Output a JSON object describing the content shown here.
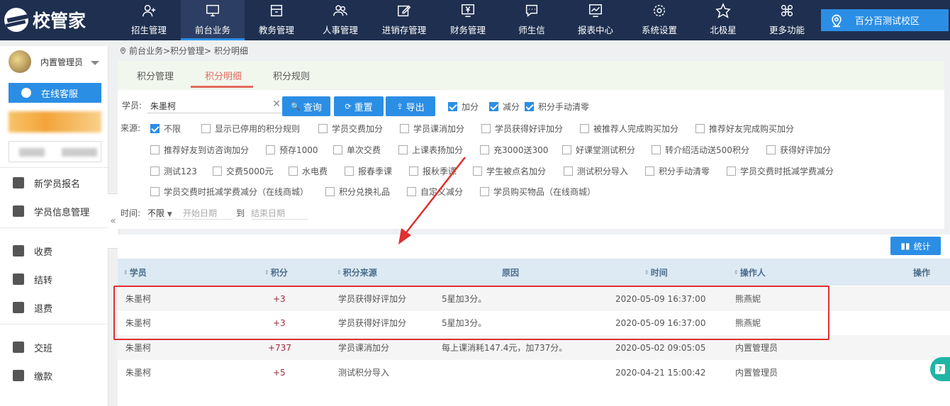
{
  "app": {
    "logo_text": "校管家"
  },
  "nav": [
    {
      "label": "招生管理",
      "icon": "user-plus-icon"
    },
    {
      "label": "前台业务",
      "icon": "monitor-icon",
      "active": true
    },
    {
      "label": "教务管理",
      "icon": "folder-icon"
    },
    {
      "label": "人事管理",
      "icon": "people-icon"
    },
    {
      "label": "进销存管理",
      "icon": "edit-icon"
    },
    {
      "label": "财务管理",
      "icon": "yuan-screen-icon"
    },
    {
      "label": "师生信",
      "icon": "chat-icon"
    },
    {
      "label": "报表中心",
      "icon": "chart-icon"
    },
    {
      "label": "系统设置",
      "icon": "gear-icon"
    },
    {
      "label": "北极星",
      "icon": "star-icon"
    },
    {
      "label": "更多功能",
      "icon": "command-icon"
    }
  ],
  "campus": {
    "label": "百分百测试校区",
    "icon": "location-icon"
  },
  "user": {
    "name": "内置管理员"
  },
  "sidebar": {
    "online_service": "在线客服",
    "items": [
      {
        "label": "新学员报名",
        "icon": "graduation-cap-icon"
      },
      {
        "label": "学员信息管理",
        "icon": "id-card-icon"
      },
      {
        "label": "收费",
        "icon": "wallet-icon"
      },
      {
        "label": "结转",
        "icon": "yuan-transfer-icon"
      },
      {
        "label": "退费",
        "icon": "refund-icon"
      },
      {
        "label": "交班",
        "icon": "handover-icon"
      },
      {
        "label": "缴款",
        "icon": "payment-icon"
      }
    ]
  },
  "breadcrumb": "前台业务>积分管理> 积分明细",
  "tabs": [
    {
      "label": "积分管理"
    },
    {
      "label": "积分明细",
      "active": true
    },
    {
      "label": "积分规则"
    }
  ],
  "filters": {
    "student_label": "学员:",
    "student_value": "朱墨柯",
    "query_btn": "查询",
    "reset_btn": "重置",
    "export_btn": "导出",
    "type_checks": [
      {
        "label": "加分",
        "checked": true
      },
      {
        "label": "减分",
        "checked": true
      },
      {
        "label": "积分手动清零",
        "checked": true
      }
    ],
    "source_label": "来源:",
    "sources": [
      {
        "label": "不限",
        "checked": true
      },
      {
        "label": "显示已停用的积分规则"
      },
      {
        "label": "学员交费加分"
      },
      {
        "label": "学员课消加分"
      },
      {
        "label": "学员获得好评加分"
      },
      {
        "label": "被推荐人完成购买加分"
      },
      {
        "label": "推荐好友完成购买加分"
      },
      {
        "label": "推荐好友到访咨询加分"
      },
      {
        "label": "预存1000"
      },
      {
        "label": "单次交费"
      },
      {
        "label": "上课表扬加分"
      },
      {
        "label": "充3000送300"
      },
      {
        "label": "好课堂测试积分"
      },
      {
        "label": "转介绍活动送500积分"
      },
      {
        "label": "获得好评加分"
      },
      {
        "label": "测试123"
      },
      {
        "label": "交费5000元"
      },
      {
        "label": "水电费"
      },
      {
        "label": "报春季课"
      },
      {
        "label": "报秋季课"
      },
      {
        "label": "学生被点名加分"
      },
      {
        "label": "测试积分导入"
      },
      {
        "label": "积分手动清零"
      },
      {
        "label": "学员交费时抵减学费减分"
      },
      {
        "label": "学员交费时抵减学费减分（在线商城）"
      },
      {
        "label": "积分兑换礼品"
      },
      {
        "label": "自定义减分"
      },
      {
        "label": "学员购买物品（在线商城）"
      }
    ],
    "time_label": "时间:",
    "time_select": "不限",
    "start_placeholder": "开始日期",
    "to_label": "到",
    "end_placeholder": "结束日期"
  },
  "stat_btn": "统计",
  "table": {
    "headers": [
      "学员",
      "积分",
      "积分来源",
      "原因",
      "时间",
      "操作人",
      "操作"
    ],
    "rows": [
      {
        "student": "朱墨柯",
        "points": "+3",
        "source": "学员获得好评加分",
        "reason": "5星加3分。",
        "time": "2020-05-09 16:37:00",
        "operator": "熊燕妮"
      },
      {
        "student": "朱墨柯",
        "points": "+3",
        "source": "学员获得好评加分",
        "reason": "5星加3分。",
        "time": "2020-05-09 16:37:00",
        "operator": "熊燕妮"
      },
      {
        "student": "朱墨柯",
        "points": "+737",
        "source": "学员课消加分",
        "reason": "每上课消耗147.4元，加737分。",
        "time": "2020-05-02 09:05:05",
        "operator": "内置管理员"
      },
      {
        "student": "朱墨柯",
        "points": "+5",
        "source": "测试积分导入",
        "reason": "",
        "time": "2020-04-21 15:00:42",
        "operator": "内置管理员"
      }
    ]
  },
  "colors": {
    "nav_bg": "#1e2f50",
    "accent": "#2b8ee5",
    "tab_active": "#e46a5c",
    "highlight": "#e03030",
    "points": "#a0263a"
  }
}
